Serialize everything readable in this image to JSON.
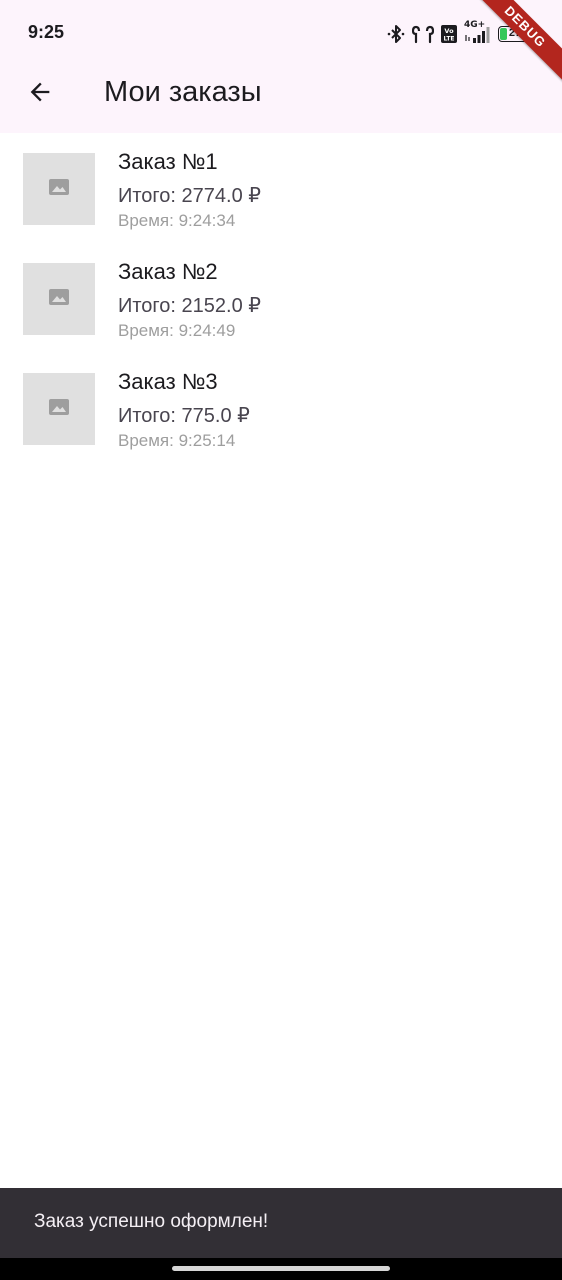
{
  "status_bar": {
    "time": "9:25",
    "battery_level": 27,
    "battery_text": "27",
    "network_label": "4G+",
    "icons": [
      "bluetooth-icon",
      "earbuds-icon",
      "volte-icon",
      "signal-icon",
      "battery-icon"
    ]
  },
  "debug_banner": "DEBUG",
  "app_bar": {
    "back_icon": "arrow-back-icon",
    "title": "Мои заказы"
  },
  "orders": [
    {
      "title": "Заказ №1",
      "total": "Итого: 2774.0 ₽",
      "time": "Время: 9:24:34",
      "thumb_icon": "image-placeholder-icon"
    },
    {
      "title": "Заказ №2",
      "total": "Итого: 2152.0 ₽",
      "time": "Время: 9:24:49",
      "thumb_icon": "image-placeholder-icon"
    },
    {
      "title": "Заказ №3",
      "total": "Итого: 775.0 ₽",
      "time": "Время: 9:25:14",
      "thumb_icon": "image-placeholder-icon"
    }
  ],
  "snackbar": {
    "message": "Заказ успешно оформлен!"
  },
  "colors": {
    "app_bar_bg": "#fdf4fc",
    "snackbar_bg": "#322f35",
    "debug_banner": "#b3261e",
    "battery_fill": "#34c759"
  }
}
